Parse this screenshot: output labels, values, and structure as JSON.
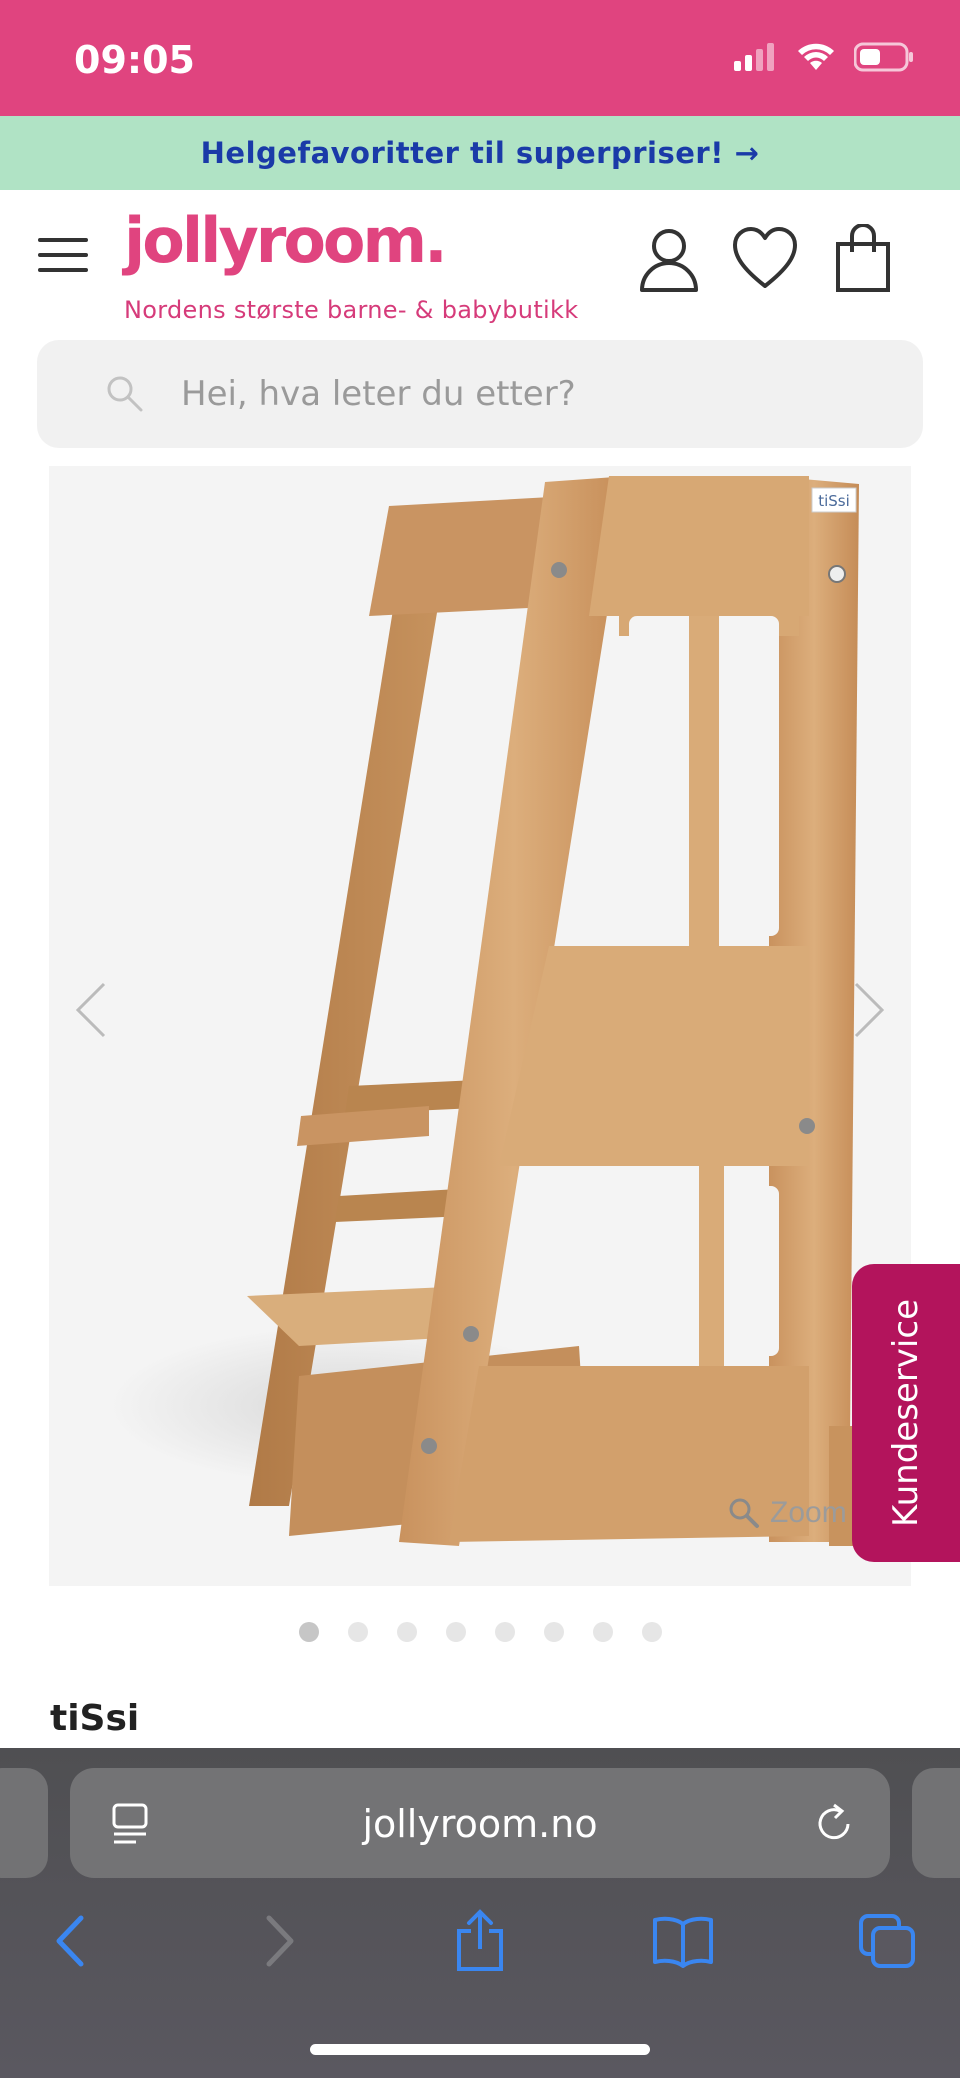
{
  "status_bar": {
    "time": "09:05",
    "signal_icon": "signal-icon",
    "wifi_icon": "wifi-icon",
    "battery_icon": "battery-icon"
  },
  "promo": {
    "text": "Helgefavoritter til superpriser! →"
  },
  "header": {
    "logo": "jollyroom.",
    "tagline": "Nordens største barne- & babybutikk",
    "icons": [
      "menu-icon",
      "account-icon",
      "heart-icon",
      "cart-icon"
    ]
  },
  "search": {
    "placeholder": "Hei, hva leter du etter?"
  },
  "gallery": {
    "zoom_label": "Zoom",
    "dot_count": 8,
    "active_dot": 1,
    "image_badge": "tiSsi"
  },
  "side_tab": {
    "label": "Kundeservice"
  },
  "product": {
    "brand": "tiSsi"
  },
  "browser": {
    "url": "jollyroom.no"
  },
  "colors": {
    "brand_pink": "#e0447f",
    "promo_green": "#b0e3c5",
    "promo_text": "#1a3aa8",
    "side_tab": "#b3145c",
    "safari_blue": "#3a86f0"
  }
}
